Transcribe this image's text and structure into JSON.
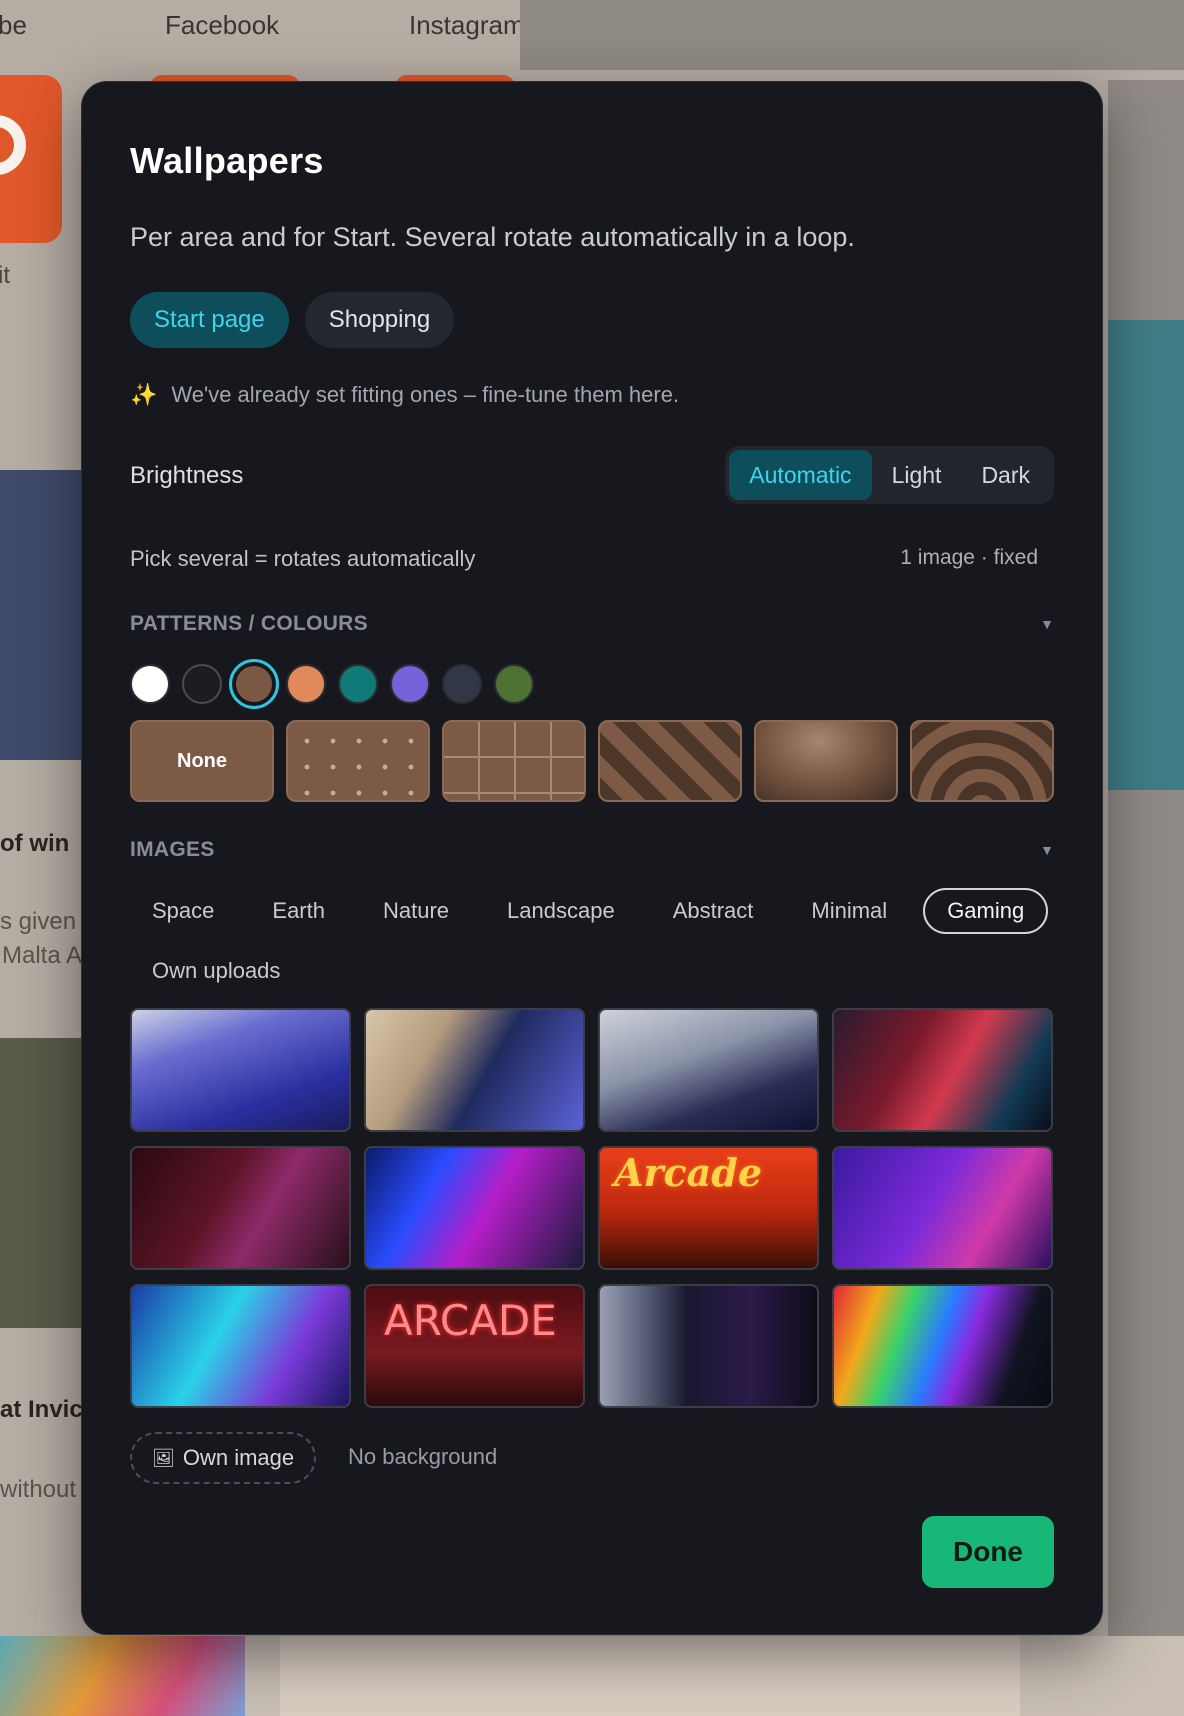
{
  "background": {
    "tabs": [
      "be",
      "Facebook",
      "Instagram"
    ],
    "labels": [
      "it",
      "of win",
      "s given",
      "Malta A",
      "at Invic",
      "without"
    ]
  },
  "modal": {
    "title": "Wallpapers",
    "subtitle": "Per area and for Start. Several rotate automatically in a loop.",
    "area_tabs": [
      {
        "label": "Start page",
        "active": true
      },
      {
        "label": "Shopping",
        "active": false
      }
    ],
    "hint": {
      "icon": "sparkles-icon",
      "text": "We've already set fitting ones – fine-tune them here."
    },
    "brightness": {
      "label": "Brightness",
      "options": [
        "Automatic",
        "Light",
        "Dark"
      ],
      "selected": "Automatic"
    },
    "pick_note": "Pick several = rotates automatically",
    "status": "1 image · fixed",
    "patterns_section": {
      "title": "PATTERNS / COLOURS",
      "colors": [
        "#ffffff",
        "#1c1d21",
        "#7a5843",
        "#e08a5a",
        "#0f7a78",
        "#7462d8",
        "#313747",
        "#4d7232"
      ],
      "selected_color": "#7a5843",
      "patterns": [
        "None",
        "dots",
        "grid",
        "stripes",
        "gradient",
        "rings"
      ],
      "selected_pattern": "None"
    },
    "images_section": {
      "title": "IMAGES",
      "categories": [
        "Space",
        "Earth",
        "Nature",
        "Landscape",
        "Abstract",
        "Minimal",
        "Gaming",
        "Own uploads"
      ],
      "selected_category": "Gaming",
      "thumbnails": [
        {
          "name": "desk-setup-headset"
        },
        {
          "name": "gamer-at-monitor"
        },
        {
          "name": "monitor-pc-dark"
        },
        {
          "name": "red-gaming-chairs"
        },
        {
          "name": "red-room-monitor"
        },
        {
          "name": "neon-arcade-hall"
        },
        {
          "name": "arcade-neon-sign",
          "text": "Arcade"
        },
        {
          "name": "purple-gaming-room"
        },
        {
          "name": "blue-wall-monitor"
        },
        {
          "name": "arcade-red-neon",
          "text": "ARCADE"
        },
        {
          "name": "arcade-cabinet-neon"
        },
        {
          "name": "rgb-monitor-setup"
        }
      ]
    },
    "own_image": {
      "icon": "image-icon",
      "label": "Own image"
    },
    "no_background": "No background",
    "done": "Done"
  }
}
